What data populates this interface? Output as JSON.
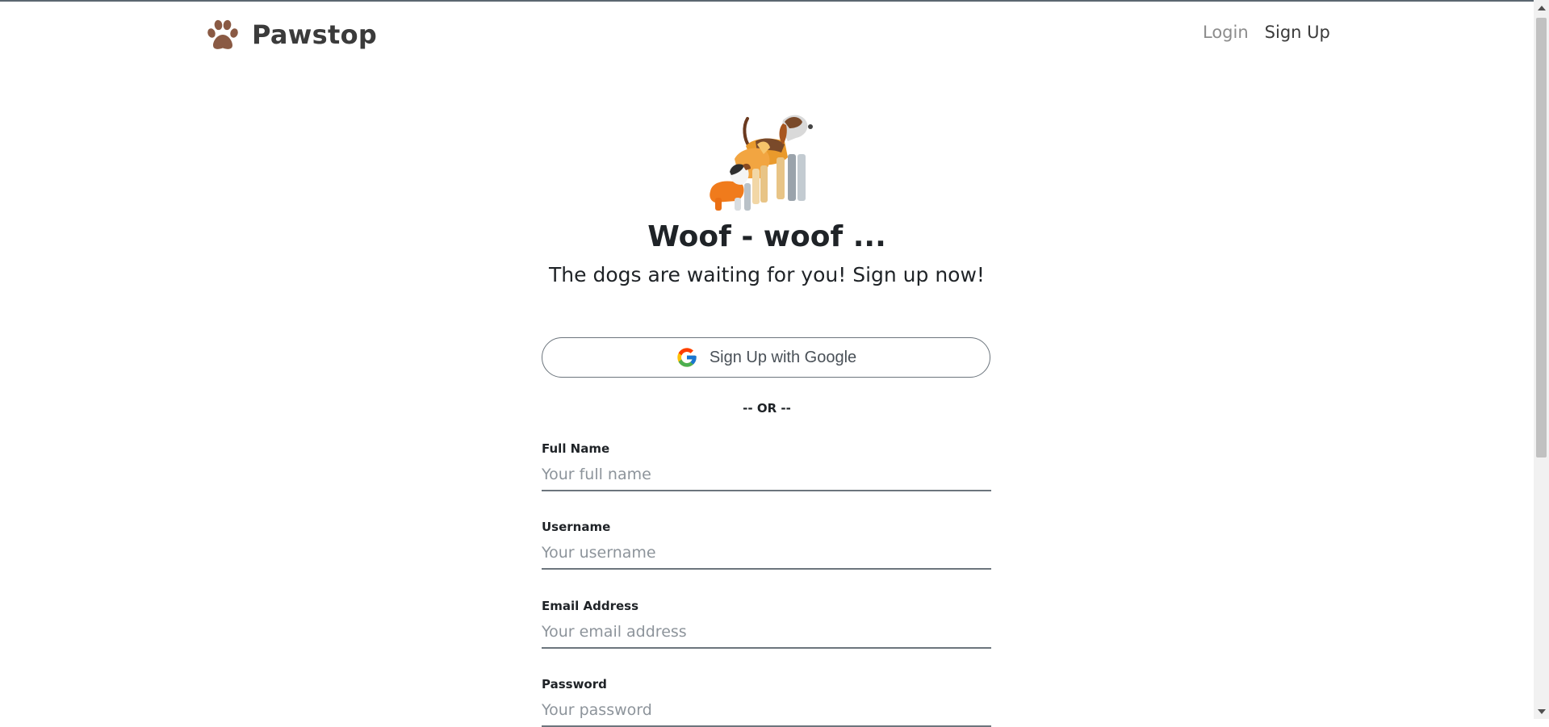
{
  "app": {
    "brand_name": "Pawstop",
    "brand_icon": "paw-icon",
    "brand_color": "#8a5a44"
  },
  "nav": {
    "login_label": "Login",
    "signup_label": "Sign Up"
  },
  "hero": {
    "image": "dogs-illustration",
    "title": "Woof - woof ...",
    "subtitle": "The dogs are waiting for you! Sign up now!"
  },
  "google_signup": {
    "label": "Sign Up with Google",
    "icon": "google-icon"
  },
  "separator": "-- OR --",
  "form": {
    "full_name": {
      "label": "Full Name",
      "placeholder": "Your full name",
      "value": ""
    },
    "username": {
      "label": "Username",
      "placeholder": "Your username",
      "value": ""
    },
    "email": {
      "label": "Email Address",
      "placeholder": "Your email address",
      "value": ""
    },
    "password": {
      "label": "Password",
      "placeholder": "Your password",
      "value": ""
    }
  }
}
